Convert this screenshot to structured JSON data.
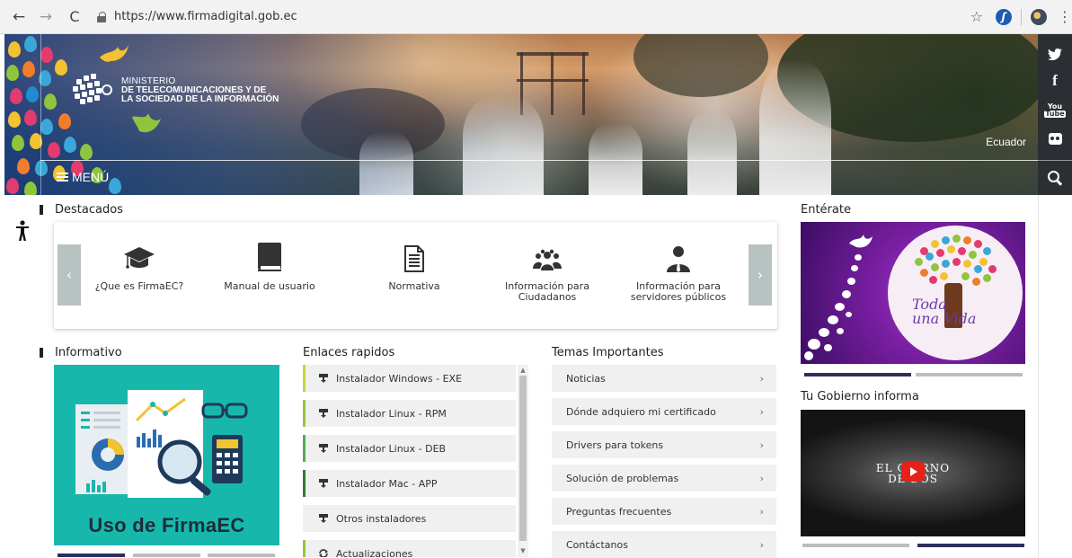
{
  "browser": {
    "back_icon": "←",
    "forward_icon": "→",
    "reload_icon": "C",
    "url": "https://www.firmadigital.gob.ec",
    "star_icon": "☆",
    "extension_label": "ʃ",
    "menu_icon": "⋮"
  },
  "header": {
    "logo_line1": "MINISTERIO",
    "logo_line2": "DE TELECOMUNICACIONES Y DE",
    "logo_line3": "LA SOCIEDAD DE LA INFORMACIÓN",
    "menu_label": "MENÚ",
    "country": "Ecuador"
  },
  "social": {
    "facebook": "f",
    "youtube_top": "You",
    "youtube_bottom": "Tube"
  },
  "destacados": {
    "title": "Destacados",
    "prev": "‹",
    "next": "›",
    "items": [
      {
        "label": "¿Que es FirmaEC?",
        "icon": "graduation-cap-icon"
      },
      {
        "label": "Manual de usuario",
        "icon": "book-icon"
      },
      {
        "label": "Normativa",
        "icon": "document-icon"
      },
      {
        "label": "Información para Ciudadanos",
        "icon": "users-icon"
      },
      {
        "label": "Información para servidores públicos",
        "icon": "user-tie-icon"
      }
    ]
  },
  "informativo": {
    "title": "Informativo",
    "caption": "Uso de FirmaEC"
  },
  "enlaces": {
    "title": "Enlaces rapidos",
    "items": [
      {
        "label": "Instalador Windows - EXE",
        "color": "#c9d43a"
      },
      {
        "label": "Instalador Linux - RPM",
        "color": "#9bc43a"
      },
      {
        "label": "Instalador Linux - DEB",
        "color": "#4caf50"
      },
      {
        "label": "Instalador Mac - APP",
        "color": "#2e7d32"
      },
      {
        "label": "Otros instaladores",
        "color": "#f0f0f0"
      },
      {
        "label": "Actualizaciones",
        "color": "#9bc43a"
      }
    ]
  },
  "temas": {
    "title": "Temas Importantes",
    "items": [
      "Noticias",
      "Dónde adquiero mi certificado",
      "Drivers para tokens",
      "Solución de problemas",
      "Preguntas frecuentes",
      "Contáctanos"
    ],
    "chevron": "›"
  },
  "enterate": {
    "title": "Entérate",
    "image_text_1": "Toda",
    "image_text_2": "una Vida"
  },
  "gobierno": {
    "title": "Tu Gobierno informa",
    "video_text_1": "EL GO     RNO",
    "video_text_2": "DE    DOS"
  },
  "colors": {
    "accent_navy": "#2d2f5e",
    "inactive_bar": "#bdbdbd",
    "teal": "#18b7ac",
    "social_bg": "#2b2f33"
  }
}
